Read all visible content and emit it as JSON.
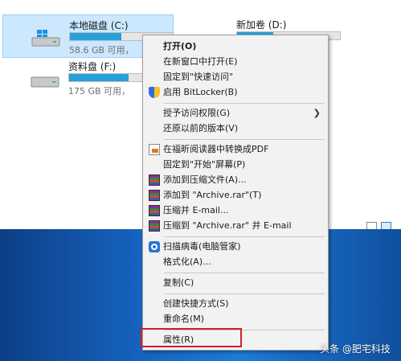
{
  "explorer": {
    "drives": [
      {
        "name": "本地磁盘 (C:)",
        "info": "58.6 GB 可用，",
        "used_fraction": 0.5,
        "selected": true
      },
      {
        "name": "资料盘 (F:)",
        "info": "175 GB 可用，",
        "used_fraction": 0.58,
        "selected": false
      },
      {
        "name": "新加卷 (D:)",
        "info": "",
        "used_fraction": 0.35,
        "selected": false
      }
    ]
  },
  "context_menu": {
    "items": [
      {
        "label": "打开(O)",
        "bold": true,
        "icon": ""
      },
      {
        "label": "在新窗口中打开(E)",
        "icon": ""
      },
      {
        "label": "固定到\"快速访问\"",
        "icon": ""
      },
      {
        "label": "启用 BitLocker(B)",
        "icon": "shield-icon"
      },
      {
        "label": "授予访问权限(G)",
        "icon": "",
        "submenu": true
      },
      {
        "label": "还原以前的版本(V)",
        "icon": ""
      },
      {
        "label": "在福昕阅读器中转换成PDF",
        "icon": "pdf-convert-icon"
      },
      {
        "label": "固定到\"开始\"屏幕(P)",
        "icon": ""
      },
      {
        "label": "添加到压缩文件(A)...",
        "icon": "winrar-icon"
      },
      {
        "label": "添加到 \"Archive.rar\"(T)",
        "icon": "winrar-icon"
      },
      {
        "label": "压缩并 E-mail...",
        "icon": "winrar-icon"
      },
      {
        "label": "压缩到 \"Archive.rar\" 并 E-mail",
        "icon": "winrar-icon"
      },
      {
        "label": "扫描病毒(电脑管家)",
        "icon": "antivirus-scan-icon"
      },
      {
        "label": "格式化(A)...",
        "icon": ""
      },
      {
        "label": "复制(C)",
        "icon": ""
      },
      {
        "label": "创建快捷方式(S)",
        "icon": ""
      },
      {
        "label": "重命名(M)",
        "icon": ""
      },
      {
        "label": "属性(R)",
        "icon": "",
        "highlighted": true
      }
    ],
    "submenu_arrow": "❯"
  },
  "watermark": "头条 @肥宅科技",
  "colors": {
    "selection_bg": "#cce8ff",
    "drive_bar_fill": "#26a0da",
    "menu_bg": "#f2f2f2",
    "highlight_border": "#d0202a",
    "desktop_blue": "#1663c0"
  }
}
